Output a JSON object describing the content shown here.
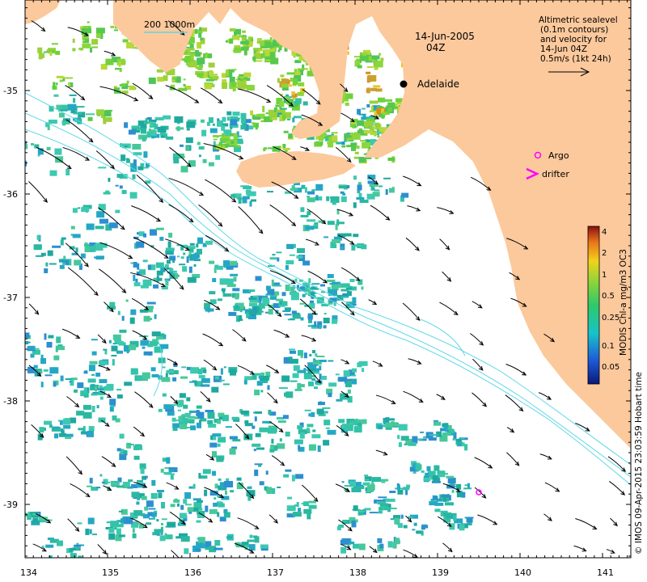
{
  "map": {
    "date_label": "14-Jun-2005",
    "time_label": "04Z",
    "city": "Adelaide",
    "scale_label": "200 1000m",
    "vector_legend": {
      "line1": "Altimetric sealevel",
      "line2": "(0.1m contours)",
      "line3": "and velocity for",
      "line4": "14-Jun 04Z",
      "line5": "0.5m/s (1kt 24h)"
    },
    "symbol_legend": {
      "argo": "Argo",
      "drifter": "drifter"
    },
    "colorbar": {
      "title": "MODIS Chl-a mg/m3 OC3",
      "ticks": [
        "4",
        "2",
        "1",
        "0.5",
        "0.25",
        "0.1",
        "0.05"
      ]
    },
    "credit": "© IMOS 09-Apr-2015 23:03:59 Hobart time",
    "x_ticks": [
      "134",
      "135",
      "136",
      "137",
      "138",
      "139",
      "140",
      "141"
    ],
    "y_ticks": [
      "-35",
      "-36",
      "-37",
      "-38",
      "-39"
    ],
    "colors": {
      "land": "#fcc99c",
      "ocean": "#ffffff",
      "contour": "#5fd8e8",
      "argo": "#ff00ff"
    }
  }
}
